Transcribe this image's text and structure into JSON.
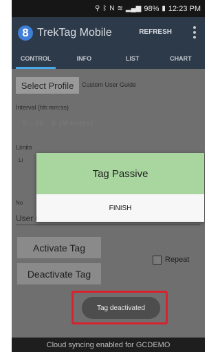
{
  "status_bar": {
    "battery": "98%",
    "time": "12:23 PM",
    "icons": [
      "location-icon",
      "bluetooth-icon",
      "nfc-icon",
      "wifi-icon",
      "signal-icon",
      "battery-icon"
    ]
  },
  "app_bar": {
    "logo_letter": "8",
    "title": "TrekTag Mobile",
    "refresh_label": "REFRESH"
  },
  "tabs": [
    {
      "label": "CONTROL",
      "active": true
    },
    {
      "label": "INFO",
      "active": false
    },
    {
      "label": "LIST",
      "active": false
    },
    {
      "label": "CHART",
      "active": false
    }
  ],
  "control": {
    "select_profile_label": "Select Profile",
    "profile_name": "Custom User Guide",
    "interval_label": "Interval (hh:mm:ss)",
    "interval_values": "0   : 30   : 0   (Minutes)",
    "limits_label": "Limits",
    "limits_fragment": "Li",
    "notes_label_fragment": "No",
    "notes_value": "User Guide Demo",
    "activate_label": "Activate Tag",
    "deactivate_label": "Deactivate Tag",
    "repeat_label": "Repeat"
  },
  "dialog": {
    "title": "Tag Passive",
    "button_label": "FINISH"
  },
  "toast": {
    "message": "Tag deactivated"
  },
  "footer": {
    "message": "Cloud syncing enabled for GCDEMO"
  },
  "colors": {
    "app_bar": "#2d3a49",
    "tab_indicator": "#4aa8e8",
    "dialog_header": "#a9d59f",
    "highlight_border": "#d8222e",
    "logo": "#3f7fd6"
  }
}
